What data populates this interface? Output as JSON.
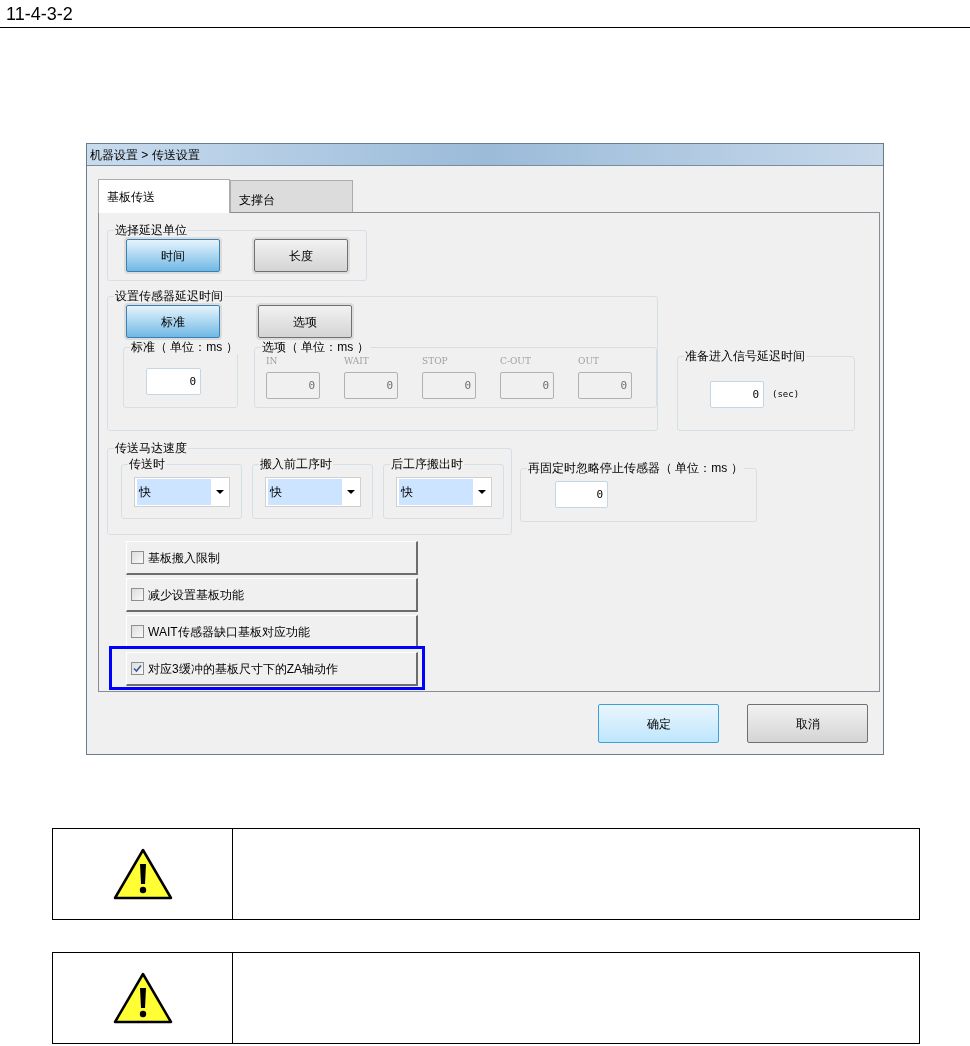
{
  "page": {
    "section": "11-4-3-2"
  },
  "dialog": {
    "title": "机器设置 > 传送设置",
    "tabs": [
      {
        "label": "基板传送",
        "selected": true
      },
      {
        "label": "支撑台",
        "selected": false
      }
    ],
    "delay_unit": {
      "legend": "选择延迟单位",
      "options": [
        {
          "label": "时间",
          "selected": true
        },
        {
          "label": "长度",
          "selected": false
        }
      ]
    },
    "sensor_delay": {
      "legend": "设置传感器延迟时间",
      "modes": [
        {
          "label": "标准",
          "selected": true
        },
        {
          "label": "选项",
          "selected": false
        }
      ],
      "standard": {
        "legend": "标准（ 单位：ms ）",
        "value": "0"
      },
      "options": {
        "legend": "选项（ 单位：ms ）",
        "disabled": true,
        "fields": [
          {
            "label": "IN",
            "value": "0"
          },
          {
            "label": "WAIT",
            "value": "0"
          },
          {
            "label": "STOP",
            "value": "0"
          },
          {
            "label": "C-OUT",
            "value": "0"
          },
          {
            "label": "OUT",
            "value": "0"
          }
        ]
      }
    },
    "ready_delay": {
      "legend": "准备进入信号延迟时间",
      "value": "0",
      "unit": "(sec)"
    },
    "motor_speed": {
      "legend": "传送马达速度",
      "selects": [
        {
          "label": "传送时",
          "value": "快"
        },
        {
          "label": "搬入前工序时",
          "value": "快"
        },
        {
          "label": "后工序搬出时",
          "value": "快"
        }
      ]
    },
    "refix_ignore": {
      "legend": "再固定时忽略停止传感器（ 单位：ms ）",
      "value": "0"
    },
    "checks": [
      {
        "label": "基板搬入限制",
        "checked": false,
        "highlighted": false
      },
      {
        "label": "减少设置基板功能",
        "checked": false,
        "highlighted": false
      },
      {
        "label": "WAIT传感器缺口基板对应功能",
        "checked": false,
        "highlighted": false
      },
      {
        "label": "对应3缓冲的基板尺寸下的ZA轴动作",
        "checked": true,
        "highlighted": true
      }
    ],
    "buttons": [
      {
        "label": "确定",
        "default": true
      },
      {
        "label": "取消",
        "default": false
      }
    ]
  },
  "cautions": [
    {
      "kind": "caution"
    },
    {
      "kind": "caution"
    }
  ]
}
